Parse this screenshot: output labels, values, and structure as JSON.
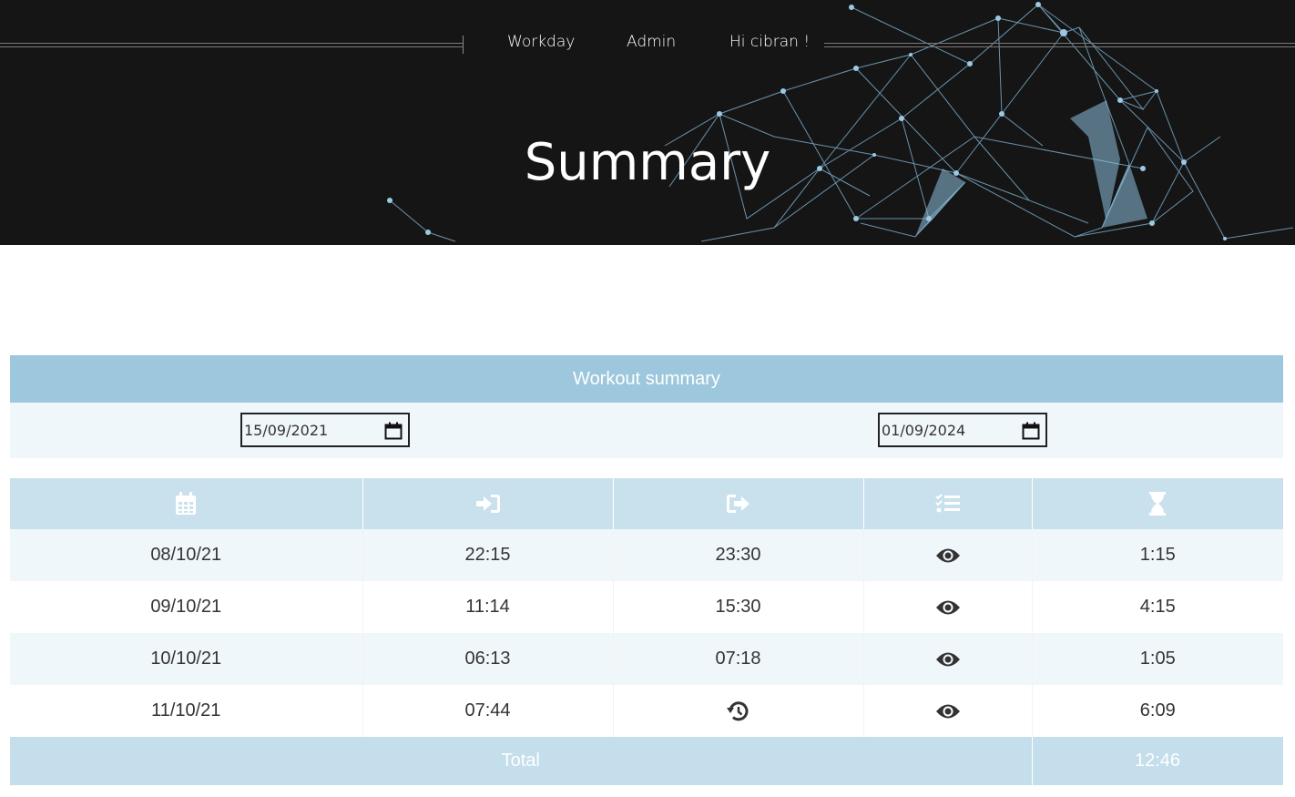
{
  "nav": {
    "items": [
      "Workday",
      "Admin",
      "Hi cibran !"
    ]
  },
  "hero": {
    "title": "Summary"
  },
  "summary": {
    "title": "Workout summary",
    "start_date": "15/09/2021",
    "end_date": "01/09/2024"
  },
  "table": {
    "header_icons": [
      "calendar-icon",
      "sign-in-icon",
      "sign-out-icon",
      "tasks-list-icon",
      "hourglass-icon"
    ],
    "rows": [
      {
        "date": "08/10/21",
        "check_in": "22:15",
        "check_out": "23:30",
        "duration": "1:15",
        "check_out_icon": null
      },
      {
        "date": "09/10/21",
        "check_in": "11:14",
        "check_out": "15:30",
        "duration": "4:15",
        "check_out_icon": null
      },
      {
        "date": "10/10/21",
        "check_in": "06:13",
        "check_out": "07:18",
        "duration": "1:05",
        "check_out_icon": null
      },
      {
        "date": "11/10/21",
        "check_in": "07:44",
        "check_out": "",
        "duration": "6:09",
        "check_out_icon": "history-icon"
      }
    ],
    "total_label": "Total",
    "total_value": "12:46"
  },
  "colors": {
    "hero_bg": "#151516",
    "accent": "#9dc7dd",
    "header_row": "#c9e1ed",
    "stripe": "#f0f7fb",
    "network": "#7fb3d0"
  }
}
